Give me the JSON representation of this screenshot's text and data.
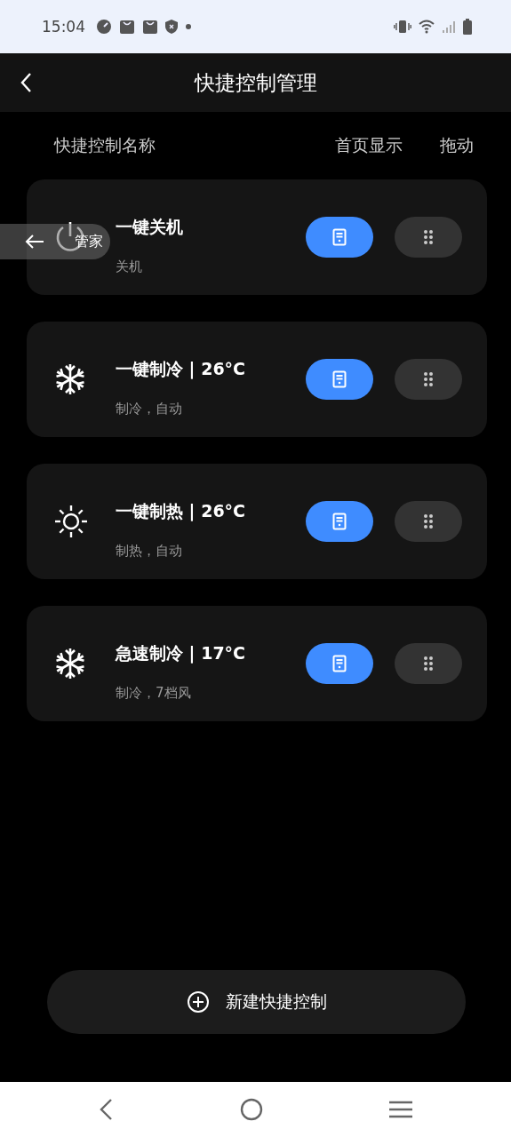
{
  "status_bar": {
    "time": "15:04"
  },
  "header": {
    "title": "快捷控制管理"
  },
  "columns": [
    "快捷控制名称",
    "首页显示",
    "拖动"
  ],
  "items": [
    {
      "kind": "power",
      "name": "一键关机",
      "detail": "关机",
      "home_display": true
    },
    {
      "kind": "snowflake",
      "name": "一键制冷 | 26°C",
      "detail": "制冷，自动",
      "home_display": true
    },
    {
      "kind": "sun",
      "name": "一键制热 | 26°C",
      "detail": "制热，自动",
      "home_display": true
    },
    {
      "kind": "snowflake",
      "name": "急速制冷 | 17°C",
      "detail": "制冷，7档风",
      "home_display": true
    }
  ],
  "add_button": {
    "label": "新建快捷控制"
  },
  "floating_back": {
    "label": "管家"
  }
}
